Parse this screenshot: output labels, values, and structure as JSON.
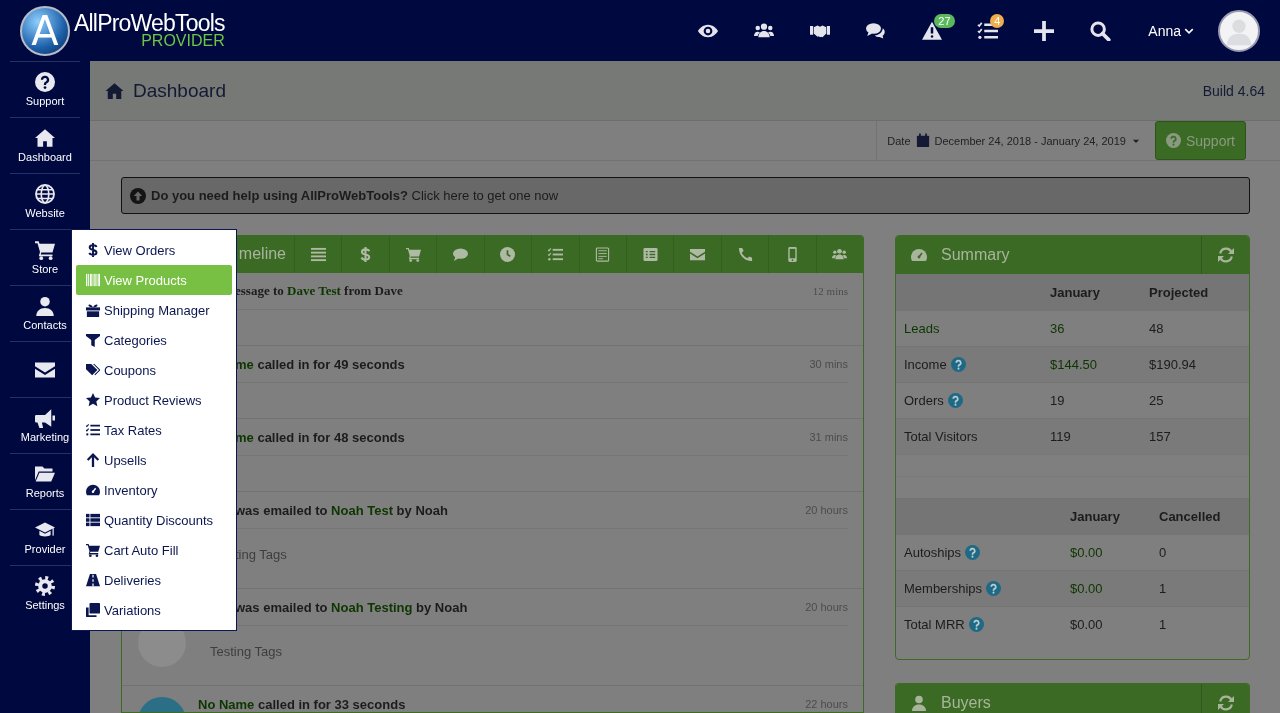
{
  "header": {
    "logo_mark": "A",
    "brand": "AllProWebTools",
    "brand_sub": "PROVIDER",
    "user": "Anna",
    "tools": [
      {
        "kind": "eye"
      },
      {
        "kind": "users"
      },
      {
        "kind": "handshake"
      },
      {
        "kind": "comments"
      },
      {
        "kind": "warning",
        "badge": "27",
        "color": "#5cb85c"
      },
      {
        "kind": "tasks",
        "badge": "4",
        "color": "#f0ad4e"
      },
      {
        "kind": "plus"
      },
      {
        "kind": "search"
      }
    ]
  },
  "sidebar": [
    {
      "kind": "question",
      "label": "Support"
    },
    {
      "kind": "home",
      "label": "Dashboard"
    },
    {
      "kind": "globe",
      "label": "Website"
    },
    {
      "kind": "cart",
      "label": "Store"
    },
    {
      "kind": "user",
      "label": "Contacts"
    },
    {
      "kind": "envelope"
    },
    {
      "kind": "bullhorn",
      "label": "Marketing"
    },
    {
      "kind": "folder",
      "label": "Reports"
    },
    {
      "kind": "cap",
      "label": "Provider"
    },
    {
      "kind": "gear",
      "label": "Settings"
    }
  ],
  "page": {
    "title": "Dashboard",
    "build": "Build 4.64"
  },
  "toolbar": {
    "date_label": "Date",
    "date_range": "December 24, 2018 - January 24, 2019",
    "support_button": "Support"
  },
  "help_banner": "**Do you need help using AllProWebTools?** Click here to get one now",
  "store_menu": [
    {
      "label": "View Orders",
      "selected": false
    },
    {
      "label": "View Products",
      "selected": true
    },
    {
      "label": "Shipping Manager",
      "selected": false
    },
    {
      "label": "Categories",
      "selected": false
    },
    {
      "label": "Coupons",
      "selected": false
    },
    {
      "label": "Product Reviews",
      "selected": false
    },
    {
      "label": "Tax Rates",
      "selected": false
    },
    {
      "label": "Upsells",
      "selected": false
    },
    {
      "label": "Inventory",
      "selected": false
    },
    {
      "label": "Quantity Discounts",
      "selected": false
    },
    {
      "label": "Cart Auto Fill",
      "selected": false
    },
    {
      "label": "Deliveries",
      "selected": false
    },
    {
      "label": "Variations",
      "selected": false
    }
  ],
  "timeline": {
    "tab_label": "meline",
    "rows": [
      {
        "kind": "message",
        "title": [
          {
            "text": "essage to "
          },
          {
            "text": "Dave Test",
            "link": true
          },
          {
            "text": " from Dave"
          }
        ],
        "time": "12 mins"
      },
      {
        "kind": "call",
        "title": [
          {
            "text": "me",
            "link": true
          },
          {
            "text": " called in for 49 seconds"
          }
        ],
        "time": "30 mins"
      },
      {
        "kind": "call",
        "title": [
          {
            "text": "me",
            "link": true
          },
          {
            "text": " called in for 48 seconds"
          }
        ],
        "time": "31 mins"
      },
      {
        "kind": "email",
        "title": [
          {
            "text": "was emailed to "
          },
          {
            "text": "Noah Test",
            "link": true
          },
          {
            "text": " by Noah"
          }
        ],
        "time": "20 hours",
        "note": "ting Tags"
      },
      {
        "kind": "email",
        "title": [
          {
            "text": "was emailed to "
          },
          {
            "text": "Noah Testing",
            "link": true
          },
          {
            "text": " by Noah"
          }
        ],
        "time": "20 hours",
        "note": "Testing Tags",
        "color": "#8c8c8c"
      },
      {
        "kind": "call",
        "title": [
          {
            "text": "No Name",
            "link": true
          },
          {
            "text": " called in for 33 seconds"
          }
        ],
        "time": "22 hours",
        "color": "#2b6f87"
      }
    ]
  },
  "summary": {
    "title": "Summary",
    "tables": [
      {
        "columns": [
          "",
          "January",
          "Projected"
        ],
        "rows": [
          {
            "cells": [
              {
                "text": "Leads",
                "link": true
              },
              {
                "text": "36",
                "link": true
              },
              {
                "text": "48"
              }
            ]
          },
          {
            "help": true,
            "cells": [
              {
                "text": "Income"
              },
              {
                "text": "$144.50",
                "link": true
              },
              {
                "text": "$190.94"
              }
            ]
          },
          {
            "help": true,
            "cells": [
              {
                "text": "Orders"
              },
              {
                "text": "19"
              },
              {
                "text": "25"
              }
            ]
          },
          {
            "cells": [
              {
                "text": "Total Visitors"
              },
              {
                "text": "119"
              },
              {
                "text": "157"
              }
            ]
          }
        ]
      },
      {
        "columns": [
          "",
          "January",
          "Cancelled"
        ],
        "rows": [
          {
            "help": true,
            "cells": [
              {
                "text": "Autoships"
              },
              {
                "text": "$0.00",
                "link": true
              },
              {
                "text": "0"
              }
            ]
          },
          {
            "help": true,
            "cells": [
              {
                "text": "Memberships"
              },
              {
                "text": "$0.00",
                "link": true
              },
              {
                "text": "1"
              }
            ]
          },
          {
            "help": true,
            "cells": [
              {
                "text": "Total MRR"
              },
              {
                "text": "$0.00"
              },
              {
                "text": "1"
              }
            ]
          }
        ]
      }
    ]
  },
  "buyers": {
    "title": "Buyers"
  }
}
